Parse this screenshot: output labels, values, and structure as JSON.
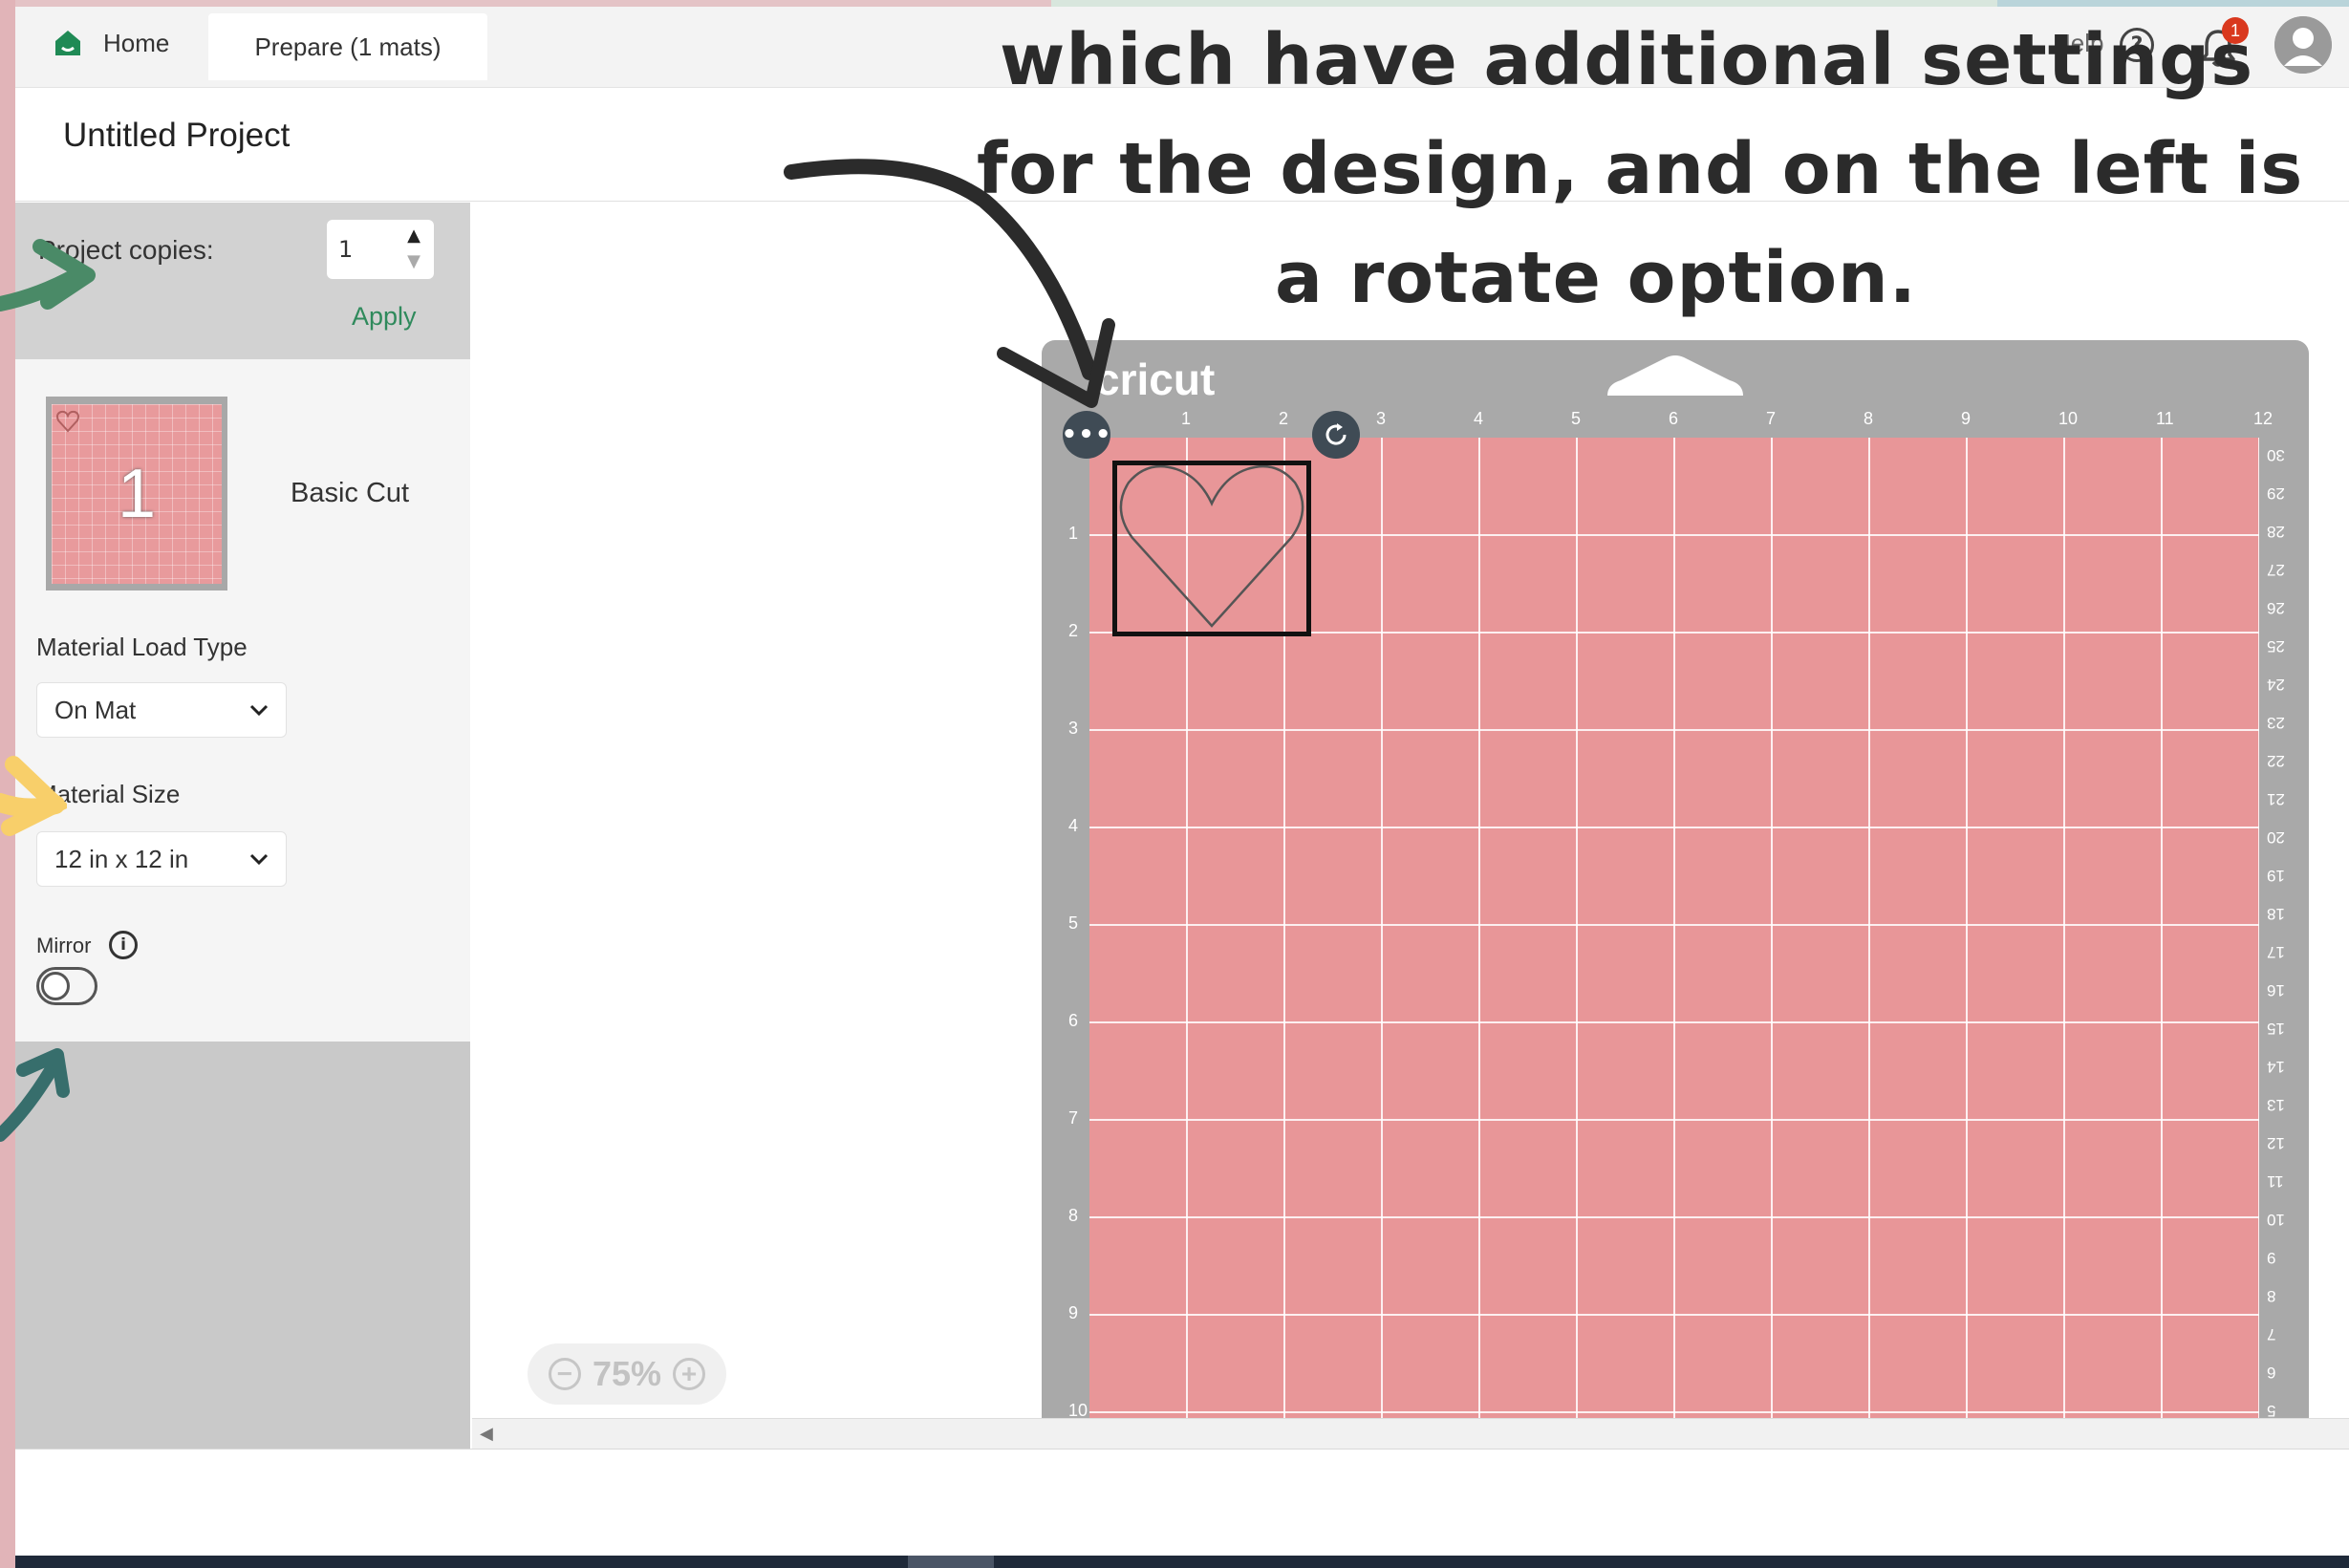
{
  "header": {
    "tabs": [
      {
        "label": "Home",
        "icon": "home-icon"
      },
      {
        "label": "Prepare (1 mats)"
      }
    ],
    "help_label": "Help",
    "notification_count": "1"
  },
  "project": {
    "title": "Untitled Project"
  },
  "sidebar": {
    "copies_label": "Project copies:",
    "copies_value": "1",
    "apply_label": "Apply",
    "mat_number": "1",
    "mat_label": "Basic Cut",
    "load_type_label": "Material Load Type",
    "load_type_value": "On Mat",
    "size_label": "Material Size",
    "size_value": "12 in x 12 in",
    "mirror_label": "Mirror",
    "mirror_on": false
  },
  "canvas": {
    "zoom": "75%",
    "mat_brand": "cricut",
    "mat_color": "#e89698",
    "top_ticks": [
      "1",
      "2",
      "3",
      "4",
      "5",
      "6",
      "7",
      "8",
      "9",
      "10",
      "11",
      "12"
    ],
    "left_ticks": [
      "1",
      "2",
      "3",
      "4",
      "5",
      "6",
      "7",
      "8",
      "9",
      "10"
    ],
    "right_ticks": [
      "30",
      "29",
      "28",
      "27",
      "26",
      "25",
      "24",
      "23",
      "22",
      "21",
      "20",
      "19",
      "18",
      "17",
      "16",
      "15",
      "14",
      "13",
      "12",
      "11",
      "10",
      "9",
      "8",
      "7",
      "6",
      "5"
    ]
  },
  "caption": {
    "lines": [
      "which have additional settings",
      "for the design, and on the left is",
      "a rotate option."
    ]
  },
  "colors": {
    "accent_green": "#2f8a5c",
    "badge_red": "#d9381e",
    "button_dark": "#3f4b55"
  }
}
